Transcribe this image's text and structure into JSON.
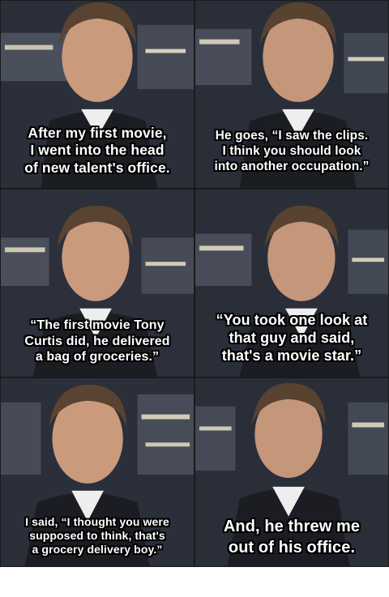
{
  "panels": [
    {
      "lines": [
        "After my first movie,",
        "I went into the head",
        "of new talent's office."
      ]
    },
    {
      "lines": [
        "He goes, “I saw the clips.",
        "I think you should look",
        "into another occupation.”"
      ]
    },
    {
      "lines": [
        "“The first movie Tony",
        "Curtis did, he delivered",
        "a bag of groceries.”"
      ]
    },
    {
      "lines": [
        "“You took one look at",
        "that guy and said,",
        "that's a movie star.”"
      ]
    },
    {
      "lines": [
        "I said, “I thought you were",
        "supposed to think, that's",
        "a grocery delivery boy.”"
      ]
    },
    {
      "lines": [
        "And, he threw me",
        "out of his office."
      ]
    }
  ],
  "colors": {
    "caption_text": "#ffffff",
    "caption_outline": "#000000",
    "studio_night": "#2b2f3a",
    "skin": "#c99a7c",
    "hair": "#5a4330",
    "suit": "#1c1d22"
  }
}
